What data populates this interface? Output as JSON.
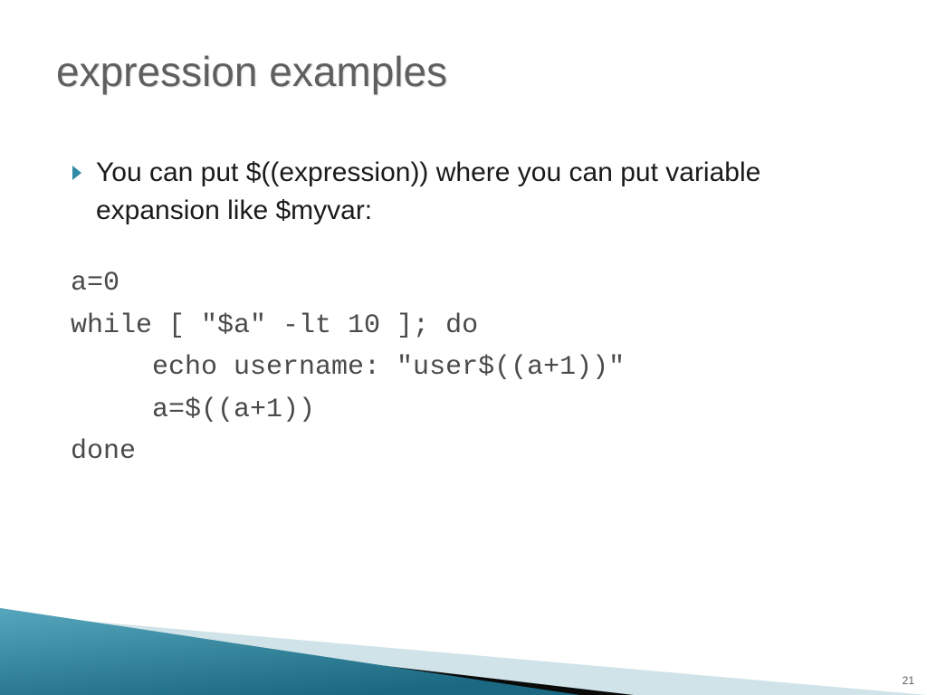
{
  "title": "expression examples",
  "bullet": "You can put $((expression)) where you can put variable expansion like $myvar:",
  "code": "a=0\nwhile [ \"$a\" -lt 10 ]; do\n     echo username: \"user$((a+1))\"\n     a=$((a+1))\ndone",
  "page_number": "21",
  "colors": {
    "accent": "#2f8aa6",
    "decor_light": "#cfe3e8",
    "decor_mid": "#1f6c85",
    "decor_dark": "#0a0a0a"
  }
}
